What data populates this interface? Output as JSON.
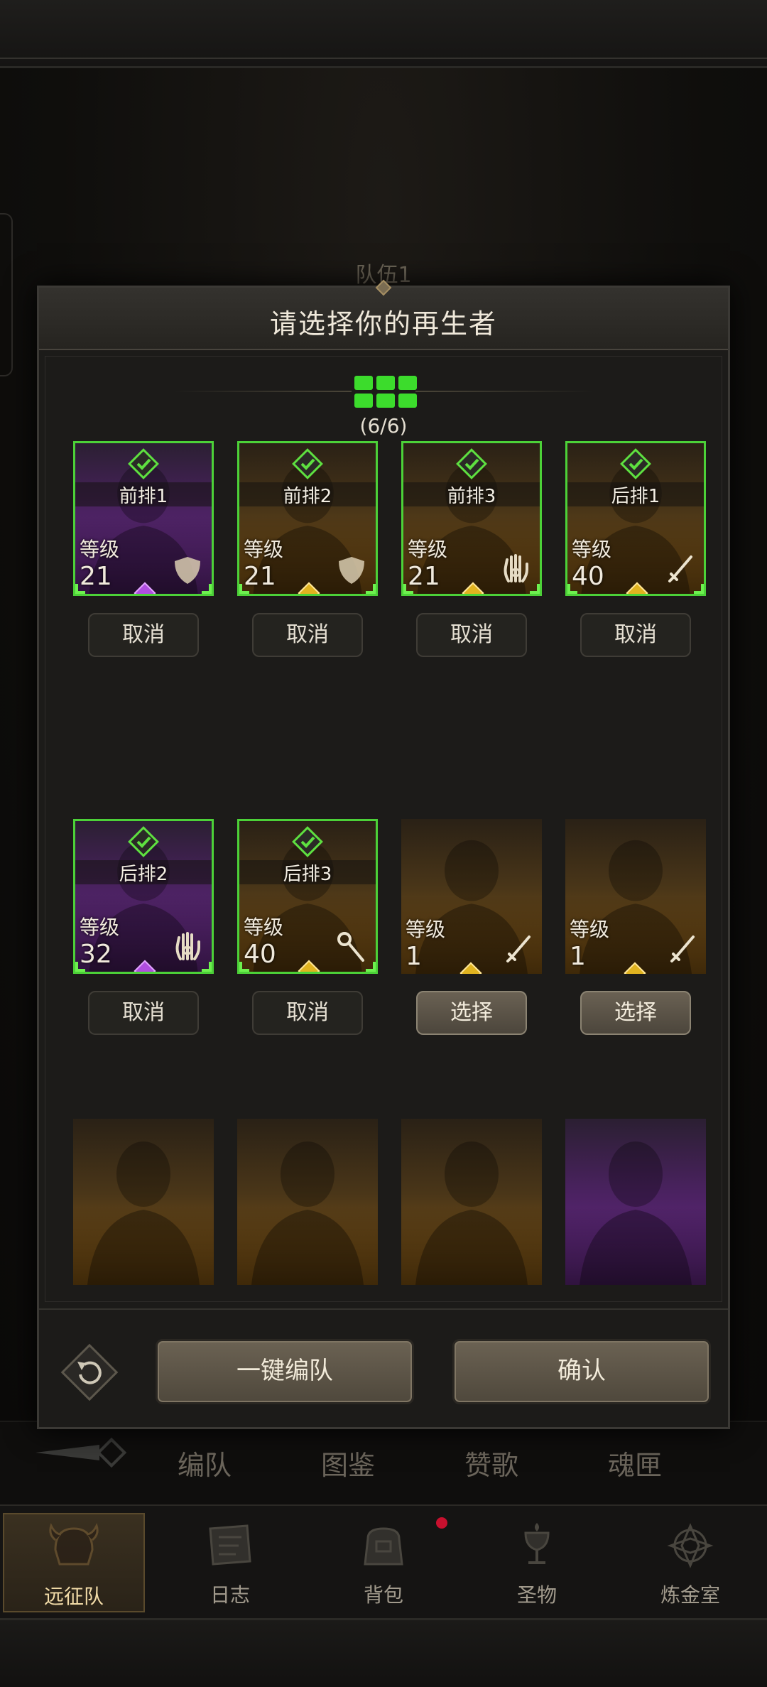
{
  "background": {
    "team_title": "队伍1",
    "subnav_tabs": [
      "编队",
      "图鉴",
      "赞歌",
      "魂匣"
    ],
    "bottom_nav": [
      {
        "label": "远征队",
        "icon": "helmet-icon",
        "active": true
      },
      {
        "label": "日志",
        "icon": "scroll-icon",
        "active": false
      },
      {
        "label": "背包",
        "icon": "bag-icon",
        "active": false
      },
      {
        "label": "圣物",
        "icon": "chalice-icon",
        "active": false
      },
      {
        "label": "炼金室",
        "icon": "alchemy-icon",
        "active": false
      }
    ]
  },
  "modal": {
    "title": "请选择你的再生者",
    "slot_count": "(6/6)",
    "level_label": "等级",
    "cancel_label": "取消",
    "select_label": "选择",
    "auto_team_label": "一键编队",
    "confirm_label": "确认",
    "colors": {
      "selected_border": "#4cd138",
      "purple_rarity": "#6a2a8a",
      "gold_rarity": "#8a5a14"
    },
    "cards": [
      {
        "rarity": "purple",
        "selected": true,
        "position": "前排1",
        "level": "21",
        "class_icon": "shield-icon",
        "button": "取消"
      },
      {
        "rarity": "gold",
        "selected": true,
        "position": "前排2",
        "level": "21",
        "class_icon": "shield-icon",
        "button": "取消"
      },
      {
        "rarity": "gold",
        "selected": true,
        "position": "前排3",
        "level": "21",
        "class_icon": "palm-icon",
        "button": "取消"
      },
      {
        "rarity": "gold",
        "selected": true,
        "position": "后排1",
        "level": "40",
        "class_icon": "sword-icon",
        "button": "取消"
      },
      {
        "rarity": "purple",
        "selected": true,
        "position": "后排2",
        "level": "32",
        "class_icon": "palm-icon",
        "button": "取消"
      },
      {
        "rarity": "gold",
        "selected": true,
        "position": "后排3",
        "level": "40",
        "class_icon": "staff-icon",
        "button": "取消"
      },
      {
        "rarity": "gold",
        "selected": false,
        "position": "",
        "level": "1",
        "class_icon": "sword-icon",
        "button": "选择"
      },
      {
        "rarity": "gold",
        "selected": false,
        "position": "",
        "level": "1",
        "class_icon": "sword-icon",
        "button": "选择"
      },
      {
        "rarity": "gold",
        "selected": false,
        "position": "",
        "level": "",
        "class_icon": "",
        "button": ""
      },
      {
        "rarity": "gold",
        "selected": false,
        "position": "",
        "level": "",
        "class_icon": "",
        "button": ""
      },
      {
        "rarity": "gold",
        "selected": false,
        "position": "",
        "level": "",
        "class_icon": "",
        "button": ""
      },
      {
        "rarity": "purple",
        "selected": false,
        "position": "",
        "level": "",
        "class_icon": "",
        "button": ""
      }
    ]
  }
}
